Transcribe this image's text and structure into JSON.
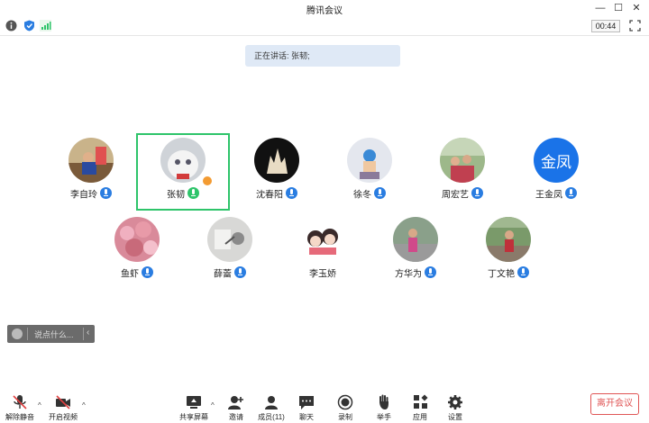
{
  "window": {
    "title": "腾讯会议"
  },
  "status": {
    "timer": "00:44",
    "icons": [
      "info-icon",
      "shield-icon",
      "signal-icon"
    ]
  },
  "speaking": {
    "text": "正在讲话: 张韧;"
  },
  "participants": [
    {
      "name": "李自玲",
      "mic": "on"
    },
    {
      "name": "张韧",
      "mic": "speaking"
    },
    {
      "name": "沈春阳",
      "mic": "on"
    },
    {
      "name": "徐冬",
      "mic": "on"
    },
    {
      "name": "周宏艺",
      "mic": "on"
    },
    {
      "name": "王金凤",
      "mic": "on",
      "avatar_text": "金凤"
    },
    {
      "name": "鱼虾",
      "mic": "on"
    },
    {
      "name": "薛蕾",
      "mic": "on"
    },
    {
      "name": "李玉娇",
      "mic": "none"
    },
    {
      "name": "方华为",
      "mic": "on"
    },
    {
      "name": "丁文艳",
      "mic": "on"
    }
  ],
  "chat": {
    "placeholder": "说点什么..."
  },
  "toolbar": {
    "unmute": "解除静音",
    "start_video": "开启视频",
    "share": "共享屏幕",
    "invite": "邀请",
    "members": "成员(11)",
    "chat": "聊天",
    "record": "录制",
    "raise_hand": "举手",
    "apps": "应用",
    "settings": "设置",
    "leave": "离开会议"
  },
  "colors": {
    "accent": "#2a7de1",
    "active_border": "#2ec46a",
    "leave": "#e05555"
  }
}
